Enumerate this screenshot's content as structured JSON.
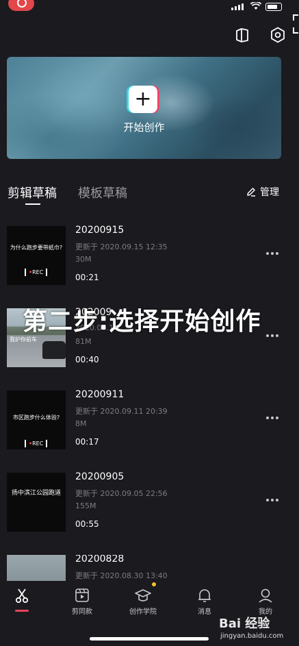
{
  "banner": {
    "create_label": "开始创作"
  },
  "tabs": {
    "drafts": "剪辑草稿",
    "templates": "模板草稿",
    "manage": "管理"
  },
  "drafts": [
    {
      "title": "20200915",
      "updated": "更新于 2020.09.15 12:35",
      "size": "30M",
      "duration": "00:21",
      "thumb_text": "为什么跑步要带纸巾?",
      "thumb_tag": "REC"
    },
    {
      "title": "202009",
      "updated": "2020.09.1",
      "size": "81M",
      "duration": "00:40",
      "thumb_text": "我护你前车"
    },
    {
      "title": "20200911",
      "updated": "更新于 2020.09.11 20:39",
      "size": "8M",
      "duration": "00:17",
      "thumb_text": "市区跑步什么体验?",
      "thumb_tag": "REC"
    },
    {
      "title": "20200905",
      "updated": "更新于 2020.09.05 22:56",
      "size": "155M",
      "duration": "00:55",
      "thumb_text": "扬中滨江公园跑道"
    },
    {
      "title": "20200828",
      "updated": "更新于 2020.08.30 13:40"
    }
  ],
  "overlay_caption": "第二步:选择开始创作",
  "nav": {
    "edit": "",
    "jiantong": "剪同款",
    "academy": "创作学院",
    "messages": "消息",
    "me": "我的"
  },
  "watermark": {
    "main": "Bai 经验",
    "sub": "jingyan.baidu.com"
  },
  "colors": {
    "accent": "#e9435b",
    "badge": "#f5c12c",
    "background": "#1b1a1f"
  }
}
